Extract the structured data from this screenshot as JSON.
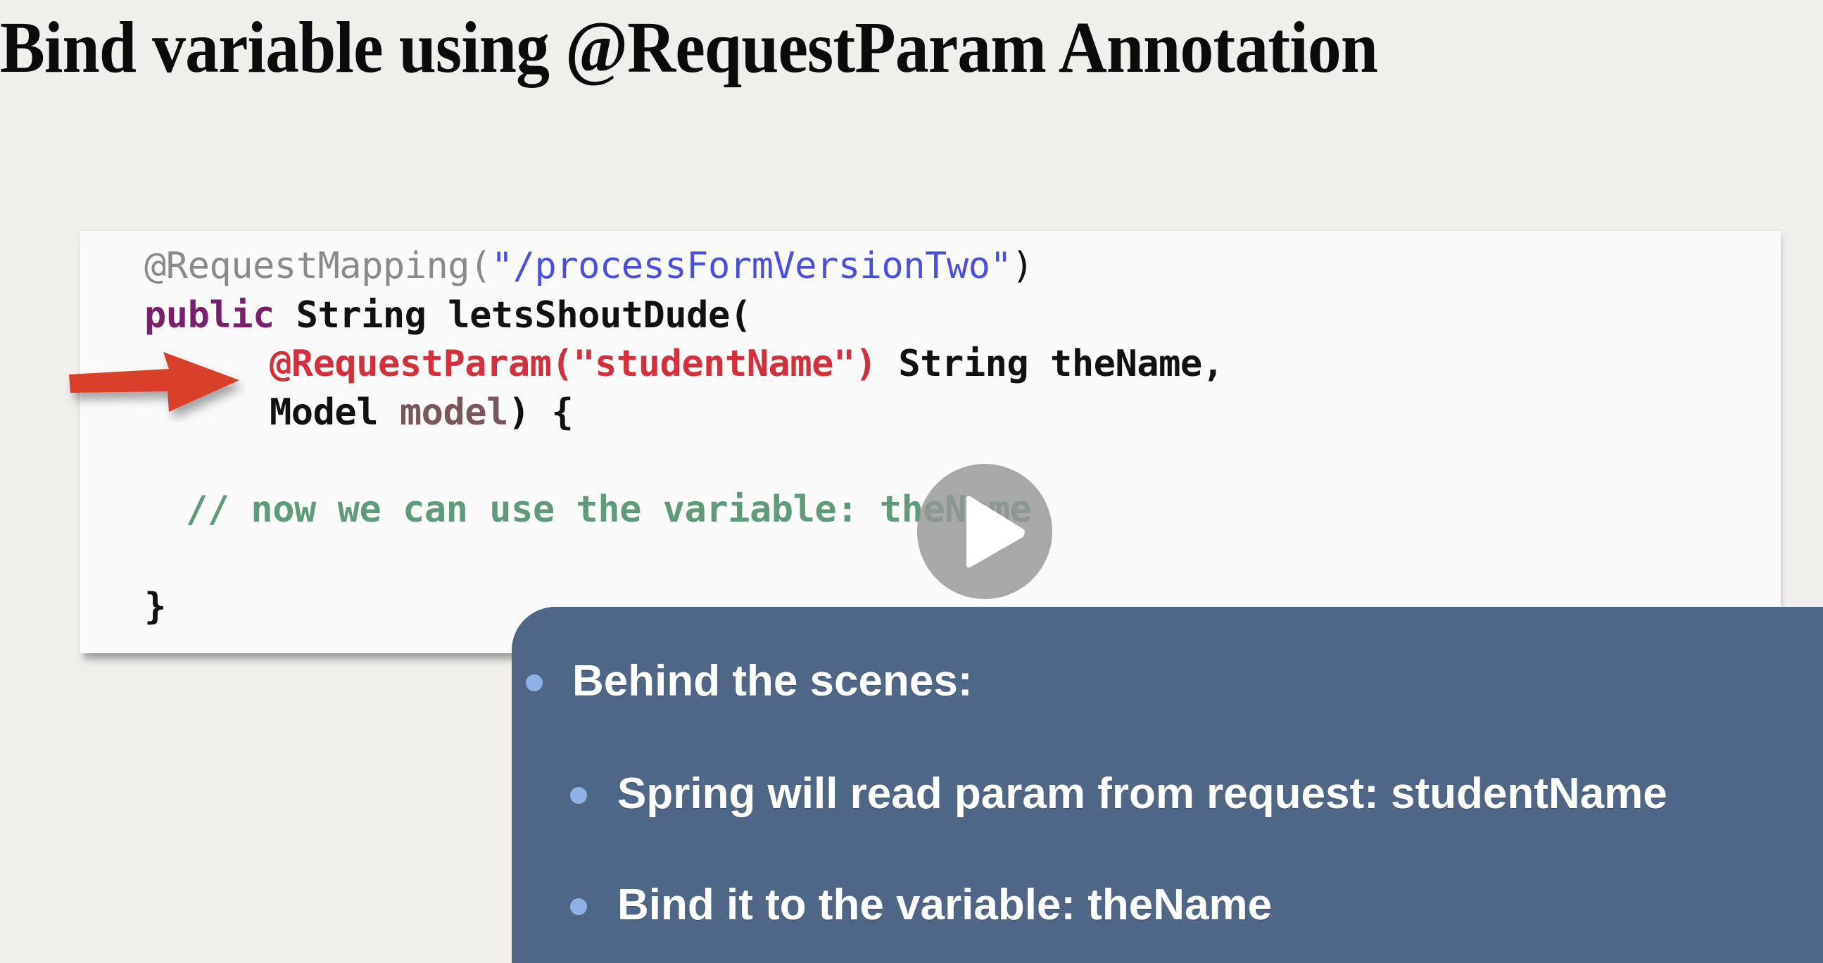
{
  "slide": {
    "title": "Bind variable using @RequestParam Annotation"
  },
  "code": {
    "line1": {
      "annotation": "@RequestMapping(",
      "path": "\"/processFormVersionTwo\"",
      "close": ")"
    },
    "line2": {
      "keyword": "public",
      "rest": " String letsShoutDude("
    },
    "line3": {
      "highlight": "@RequestParam(\"studentName\")",
      "rest": " String theName,"
    },
    "line4": {
      "type": "Model ",
      "param": "model",
      "rest": ") {"
    },
    "line5": {
      "comment": "// now we can use the variable: theName"
    },
    "line6": {
      "brace": "}"
    }
  },
  "annotations": {
    "arrow_icon": "red-arrow-right",
    "arrow_color": "#d9402a"
  },
  "player": {
    "play_icon": "play-icon"
  },
  "callout": {
    "background": "#506686",
    "bullet_color": "#8fb1e6",
    "items": [
      {
        "level": 1,
        "text": "Behind the scenes:"
      },
      {
        "level": 2,
        "text": "Spring will read param from request: studentName"
      },
      {
        "level": 2,
        "text": "Bind it to the variable: theName"
      }
    ]
  }
}
